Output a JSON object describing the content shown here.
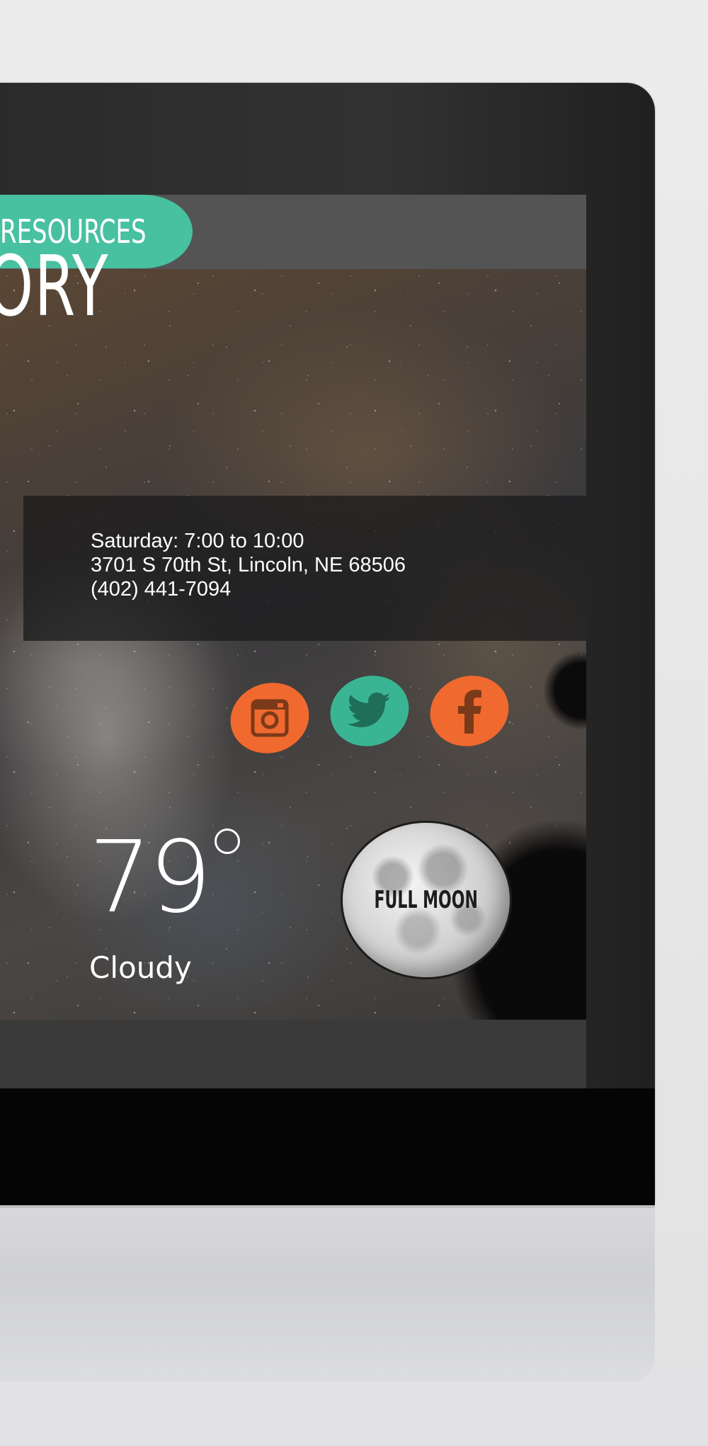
{
  "nav": {
    "resources_label": "RESOURCES"
  },
  "hero": {
    "title_fragment": "ORY"
  },
  "info": {
    "hours": "Saturday: 7:00 to 10:00",
    "address": "3701 S 70th St, Lincoln, NE 68506",
    "phone": "(402) 441-7094"
  },
  "social": [
    {
      "name": "instagram-icon",
      "color": "#f0692f"
    },
    {
      "name": "twitter-icon",
      "color": "#3ab593"
    },
    {
      "name": "facebook-icon",
      "color": "#f0692f"
    }
  ],
  "weather": {
    "temperature": "79",
    "condition": "Cloudy"
  },
  "moon": {
    "phase_label": "FULL MOON"
  },
  "colors": {
    "accent_teal": "#47c1a0",
    "accent_orange": "#f0692f"
  }
}
